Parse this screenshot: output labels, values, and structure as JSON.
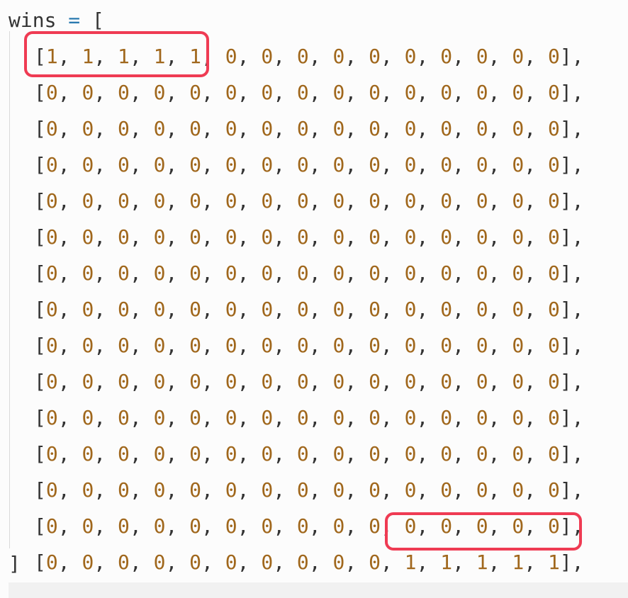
{
  "code": {
    "identifier": "wins",
    "operator": "=",
    "open_bracket": "[",
    "close_bracket": "]",
    "rows": [
      "[1, 1, 1, 1, 1, 0, 0, 0, 0, 0, 0, 0, 0, 0, 0],",
      "[0, 0, 0, 0, 0, 0, 0, 0, 0, 0, 0, 0, 0, 0, 0],",
      "[0, 0, 0, 0, 0, 0, 0, 0, 0, 0, 0, 0, 0, 0, 0],",
      "[0, 0, 0, 0, 0, 0, 0, 0, 0, 0, 0, 0, 0, 0, 0],",
      "[0, 0, 0, 0, 0, 0, 0, 0, 0, 0, 0, 0, 0, 0, 0],",
      "[0, 0, 0, 0, 0, 0, 0, 0, 0, 0, 0, 0, 0, 0, 0],",
      "[0, 0, 0, 0, 0, 0, 0, 0, 0, 0, 0, 0, 0, 0, 0],",
      "[0, 0, 0, 0, 0, 0, 0, 0, 0, 0, 0, 0, 0, 0, 0],",
      "[0, 0, 0, 0, 0, 0, 0, 0, 0, 0, 0, 0, 0, 0, 0],",
      "[0, 0, 0, 0, 0, 0, 0, 0, 0, 0, 0, 0, 0, 0, 0],",
      "[0, 0, 0, 0, 0, 0, 0, 0, 0, 0, 0, 0, 0, 0, 0],",
      "[0, 0, 0, 0, 0, 0, 0, 0, 0, 0, 0, 0, 0, 0, 0],",
      "[0, 0, 0, 0, 0, 0, 0, 0, 0, 0, 0, 0, 0, 0, 0],",
      "[0, 0, 0, 0, 0, 0, 0, 0, 0, 0, 0, 0, 0, 0, 0],",
      "[0, 0, 0, 0, 0, 0, 0, 0, 0, 0, 1, 1, 1, 1, 1],"
    ]
  },
  "colors": {
    "number": "#a0671c",
    "operator": "#2a7ab0",
    "text": "#333333",
    "highlight_border": "#ef3b53"
  }
}
